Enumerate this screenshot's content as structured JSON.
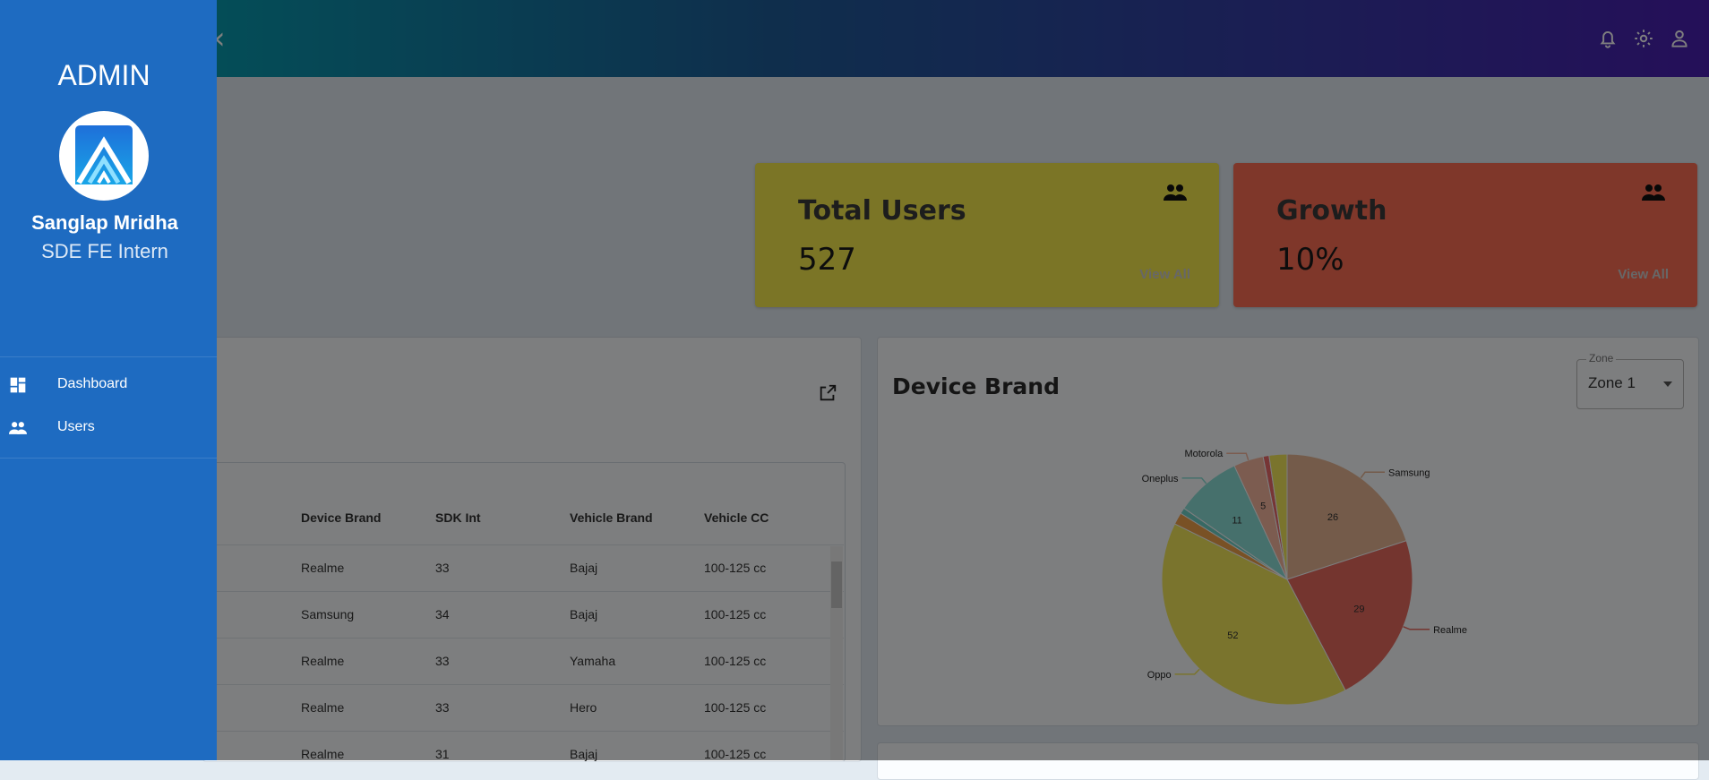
{
  "header": {
    "icons": [
      "back-chevron-icon",
      "notifications-bell-icon",
      "settings-gear-icon",
      "account-person-icon"
    ]
  },
  "sidebar": {
    "title": "ADMIN",
    "user_name": "Sanglap Mridha",
    "user_role": "SDE FE Intern",
    "items": [
      {
        "label": "Dashboard",
        "icon": "dashboard-icon"
      },
      {
        "label": "Users",
        "icon": "users-icon"
      }
    ]
  },
  "stats": [
    {
      "title": "Total Users",
      "value": "527",
      "link": "View All",
      "color": "#f7ea4c",
      "icon": "people-icon"
    },
    {
      "title": "Growth",
      "value": "10%",
      "link": "View All",
      "color": "#ff6e55",
      "icon": "people-icon"
    }
  ],
  "table": {
    "columns": [
      "Device Brand",
      "SDK Int",
      "Vehicle Brand",
      "Vehicle CC"
    ],
    "rows": [
      [
        "Realme",
        "33",
        "Bajaj",
        "100-125 cc"
      ],
      [
        "Samsung",
        "34",
        "Bajaj",
        "100-125 cc"
      ],
      [
        "Realme",
        "33",
        "Yamaha",
        "100-125 cc"
      ],
      [
        "Realme",
        "33",
        "Hero",
        "100-125 cc"
      ],
      [
        "Realme",
        "31",
        "Bajaj",
        "100-125 cc"
      ]
    ]
  },
  "device_brand": {
    "title": "Device Brand",
    "zone_label": "Zone",
    "zone_value": "Zone 1"
  },
  "chart_data": {
    "type": "pie",
    "title": "Device Brand",
    "slices": [
      {
        "name": "Samsung",
        "value": 26,
        "label": "26",
        "color": "#e8b794"
      },
      {
        "name": "Realme",
        "value": 29,
        "label": "29",
        "color": "#e86a5e"
      },
      {
        "name": "Oppo",
        "value": 52,
        "label": "52",
        "color": "#f5e95a"
      },
      {
        "name": "",
        "value": 2,
        "label": "",
        "color": "#f3a24b"
      },
      {
        "name": "",
        "value": 1,
        "label": "",
        "color": "#6fd3c8"
      },
      {
        "name": "Oneplus",
        "value": 11,
        "label": "11",
        "color": "#8ce1d8"
      },
      {
        "name": "Motorola",
        "value": 5,
        "label": "5",
        "color": "#f8b8a0"
      },
      {
        "name": "",
        "value": 1,
        "label": "",
        "color": "#ef6b6b"
      },
      {
        "name": "",
        "value": 3,
        "label": "",
        "color": "#f5e95a"
      }
    ]
  }
}
